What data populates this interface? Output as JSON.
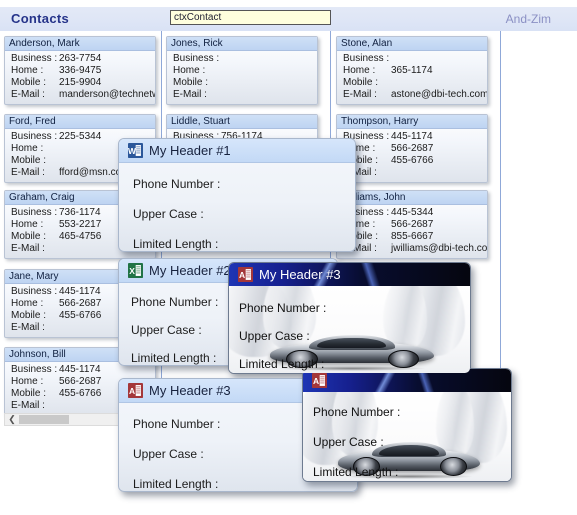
{
  "header": {
    "title": "Contacts",
    "search_value": "ctxContact",
    "range_label": "And-Zim"
  },
  "columns": [
    {
      "cards": [
        {
          "name": "Anderson, Mark",
          "rows": [
            {
              "label": "Business :",
              "value": "263-7754"
            },
            {
              "label": "Home :",
              "value": "336-9475"
            },
            {
              "label": "Mobile :",
              "value": "215-9904"
            },
            {
              "label": "E-Mail :",
              "value": "manderson@technetwork.c..."
            }
          ]
        },
        {
          "name": "Ford, Fred",
          "rows": [
            {
              "label": "Business :",
              "value": "225-5344"
            },
            {
              "label": "Home :",
              "value": ""
            },
            {
              "label": "Mobile :",
              "value": ""
            },
            {
              "label": "E-Mail :",
              "value": "fford@msn.com"
            }
          ]
        },
        {
          "name": "Graham, Craig",
          "rows": [
            {
              "label": "Business :",
              "value": "736-1174"
            },
            {
              "label": "Home :",
              "value": "553-2217"
            },
            {
              "label": "Mobile :",
              "value": "465-4756"
            },
            {
              "label": "E-Mail :",
              "value": ""
            }
          ]
        },
        {
          "name": "Jane, Mary",
          "rows": [
            {
              "label": "Business :",
              "value": "445-1174"
            },
            {
              "label": "Home :",
              "value": "566-2687"
            },
            {
              "label": "Mobile :",
              "value": "455-6766"
            },
            {
              "label": "E-Mail :",
              "value": ""
            }
          ]
        },
        {
          "name": "Johnson, Bill",
          "rows": [
            {
              "label": "Business :",
              "value": "445-1174"
            },
            {
              "label": "Home :",
              "value": "566-2687"
            },
            {
              "label": "Mobile :",
              "value": "455-6766"
            },
            {
              "label": "E-Mail :",
              "value": ""
            }
          ]
        }
      ]
    },
    {
      "cards": [
        {
          "name": "Jones, Rick",
          "rows": [
            {
              "label": "Business :",
              "value": ""
            },
            {
              "label": "Home :",
              "value": ""
            },
            {
              "label": "Mobile :",
              "value": ""
            },
            {
              "label": "E-Mail :",
              "value": ""
            }
          ]
        },
        {
          "name": "Liddle, Stuart",
          "rows": [
            {
              "label": "Business :",
              "value": "756-1174"
            },
            {
              "label": "Home :",
              "value": ""
            },
            {
              "label": "Mobile :",
              "value": ""
            },
            {
              "label": "E-Mail :",
              "value": ""
            }
          ]
        }
      ]
    },
    {
      "cards": [
        {
          "name": "Stone, Alan",
          "rows": [
            {
              "label": "Business :",
              "value": ""
            },
            {
              "label": "Home :",
              "value": "365-1174"
            },
            {
              "label": "Mobile :",
              "value": ""
            },
            {
              "label": "E-Mail :",
              "value": "astone@dbi-tech.com"
            }
          ]
        },
        {
          "name": "Thompson, Harry",
          "rows": [
            {
              "label": "Business :",
              "value": "445-1174"
            },
            {
              "label": "Home :",
              "value": "566-2687"
            },
            {
              "label": "Mobile :",
              "value": "455-6766"
            },
            {
              "label": "E-Mail :",
              "value": ""
            }
          ]
        },
        {
          "name": "Williams, John",
          "rows": [
            {
              "label": "Business :",
              "value": "445-5344"
            },
            {
              "label": "Home :",
              "value": "566-2687"
            },
            {
              "label": "Mobile :",
              "value": "855-6667"
            },
            {
              "label": "E-Mail :",
              "value": "jwilliams@dbi-tech.com"
            }
          ]
        }
      ]
    }
  ],
  "scrollbar": {
    "left_arrow": "❮"
  },
  "popups": [
    {
      "title": "My Header #1",
      "icon": "word-document-icon",
      "fields": [
        "Phone Number :",
        "Upper Case :",
        "Limited Length :"
      ]
    },
    {
      "title": "My Header #2",
      "icon": "excel-spreadsheet-icon",
      "fields": [
        "Phone Number :",
        "Upper Case :",
        "Limited Length :"
      ]
    },
    {
      "title": "My Header #3",
      "icon": "access-database-icon",
      "fields": [
        "Phone Number :",
        "Upper Case :",
        "Limited Length :"
      ]
    },
    {
      "title": "My Header #3",
      "icon": "access-database-icon",
      "fields": [
        "Phone Number :",
        "Upper Case :",
        "Limited Length :"
      ]
    },
    {
      "title": "",
      "icon": "access-database-icon",
      "fields": [
        "Phone Number :",
        "Upper Case :",
        "Limited Length :"
      ]
    }
  ],
  "colors": {
    "title": "#26348a",
    "header_band": "#dfe6f6",
    "search_bg": "#ffffdd",
    "range_text": "#8b90c4",
    "card_name_bg": "#c3d7f3",
    "divider": "#8fa8d8",
    "popup_dark_header": "#0b1030"
  }
}
